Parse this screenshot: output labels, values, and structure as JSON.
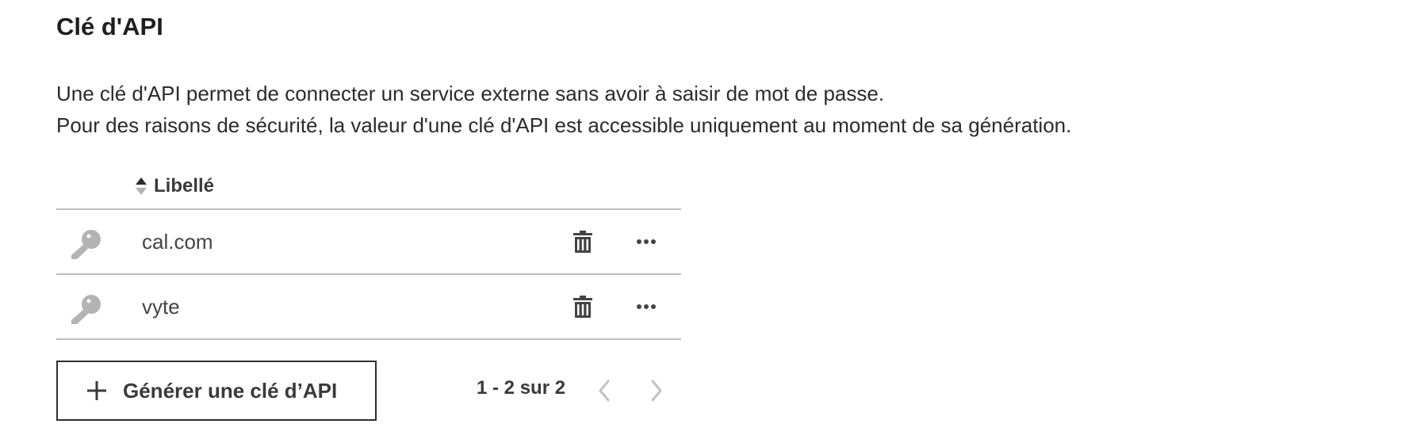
{
  "section": {
    "title": "Clé d'API",
    "description_line1": "Une clé d'API permet de connecter un service externe sans avoir à saisir de mot de passe.",
    "description_line2": "Pour des raisons de sécurité, la valeur d'une clé d'API est accessible uniquement au moment de sa génération."
  },
  "table": {
    "column_header": "Libellé",
    "rows": [
      {
        "label": "cal.com",
        "icon": "key-icon"
      },
      {
        "label": "vyte",
        "icon": "key-icon"
      }
    ]
  },
  "actions": {
    "generate_label": "Générer une clé d’API"
  },
  "pagination": {
    "text": "1 - 2 sur 2"
  },
  "colors": {
    "text": "#2b2b2b",
    "icon_muted": "#b3b3b3",
    "icon_dark": "#444444",
    "divider": "#bdbdbd"
  }
}
